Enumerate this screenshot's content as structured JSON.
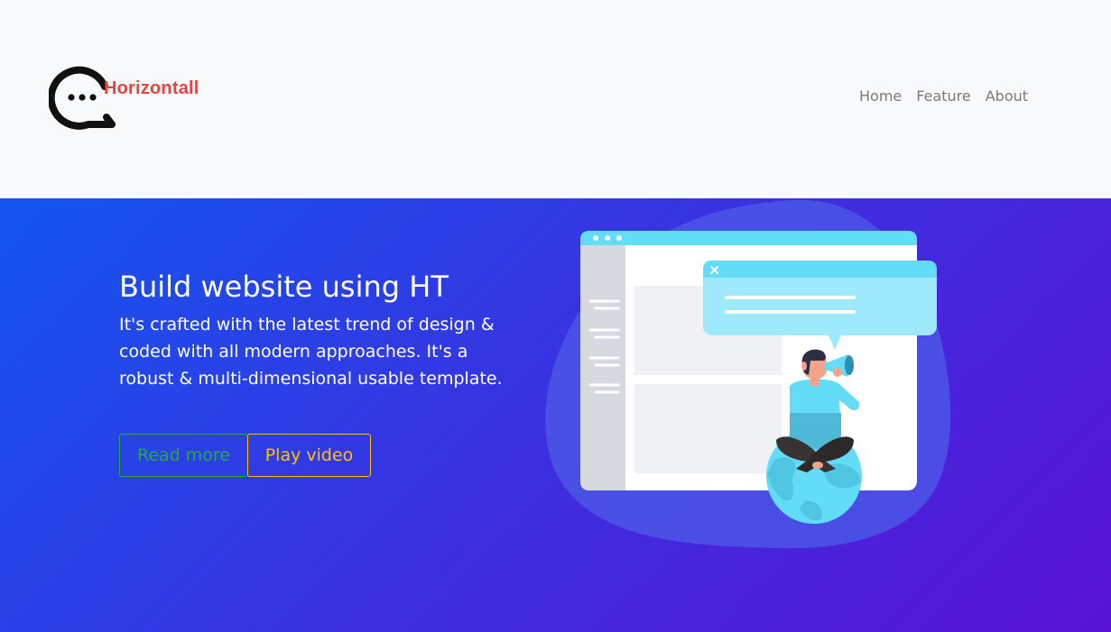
{
  "header": {
    "brand": "Horizontall",
    "nav": [
      "Home",
      "Feature",
      "About"
    ]
  },
  "hero": {
    "title": "Build website using HT",
    "lead": "It's crafted with the latest trend of design & coded with all modern approaches. It's a robust & multi-dimensional usable template.",
    "read_more_label": "Read more",
    "play_video_label": "Play video"
  },
  "colors": {
    "brand_red": "#e8443e",
    "hero_gradient_start": "#1356ee",
    "hero_gradient_end": "#5a14d6",
    "read_more": "#28a745",
    "play_video": "#ffc107"
  },
  "icons": {
    "logo": "speech-bubble-logo-icon",
    "illustration": "website-hero-illustration"
  }
}
